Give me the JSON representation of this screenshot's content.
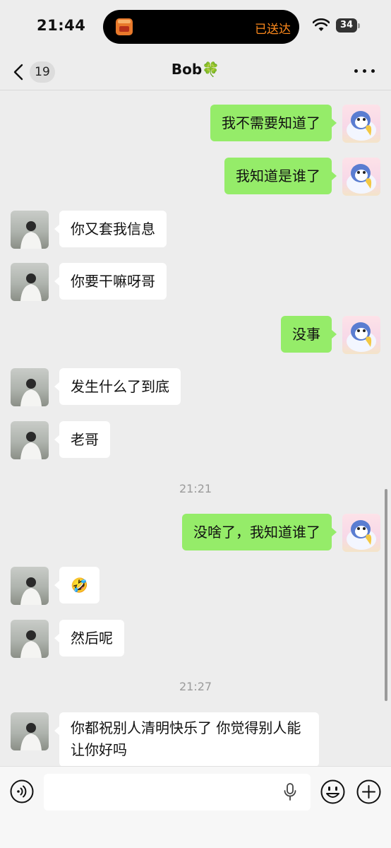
{
  "status_bar": {
    "time": "21:44",
    "live_activity_status": "已送达",
    "battery": "34"
  },
  "nav": {
    "unread_count": "19",
    "title": "Bob🍀"
  },
  "messages": [
    {
      "side": "me",
      "text": "我不需要知道了"
    },
    {
      "side": "me",
      "text": "我知道是谁了"
    },
    {
      "side": "peer",
      "text": "你又套我信息"
    },
    {
      "side": "peer",
      "text": "你要干嘛呀哥"
    },
    {
      "side": "me",
      "text": "没事"
    },
    {
      "side": "peer",
      "text": "发生什么了到底"
    },
    {
      "side": "peer",
      "text": "老哥"
    },
    {
      "type": "time",
      "text": "21:21"
    },
    {
      "side": "me",
      "text": "没啥了，我知道谁了"
    },
    {
      "side": "peer",
      "text": "🤣"
    },
    {
      "side": "peer",
      "text": "然后呢"
    },
    {
      "type": "time",
      "text": "21:27"
    },
    {
      "side": "peer",
      "text": " 你都祝别人清明快乐了 你觉得别人能让你好吗"
    }
  ],
  "input": {
    "placeholder": ""
  }
}
